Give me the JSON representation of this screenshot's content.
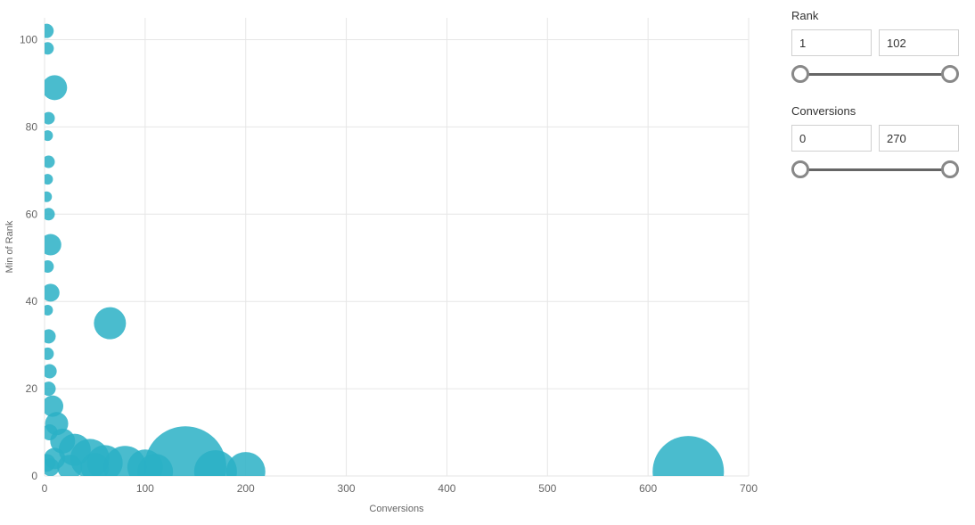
{
  "chart_data": {
    "type": "scatter",
    "xlabel": "Conversions",
    "ylabel": "Min of Rank",
    "xlim": [
      0,
      700
    ],
    "ylim": [
      0,
      105
    ],
    "x_ticks": [
      0,
      100,
      200,
      300,
      400,
      500,
      600,
      700
    ],
    "y_ticks": [
      0,
      20,
      40,
      60,
      80,
      100
    ],
    "series": [
      {
        "x": 2,
        "y": 102,
        "size": 8
      },
      {
        "x": 3,
        "y": 98,
        "size": 7
      },
      {
        "x": 10,
        "y": 89,
        "size": 14
      },
      {
        "x": 4,
        "y": 82,
        "size": 7
      },
      {
        "x": 3,
        "y": 78,
        "size": 6
      },
      {
        "x": 4,
        "y": 72,
        "size": 7
      },
      {
        "x": 3,
        "y": 68,
        "size": 6
      },
      {
        "x": 2,
        "y": 64,
        "size": 6
      },
      {
        "x": 4,
        "y": 60,
        "size": 7
      },
      {
        "x": 6,
        "y": 53,
        "size": 12
      },
      {
        "x": 3,
        "y": 48,
        "size": 7
      },
      {
        "x": 6,
        "y": 42,
        "size": 10
      },
      {
        "x": 3,
        "y": 38,
        "size": 6
      },
      {
        "x": 65,
        "y": 35,
        "size": 18
      },
      {
        "x": 4,
        "y": 32,
        "size": 8
      },
      {
        "x": 3,
        "y": 28,
        "size": 7
      },
      {
        "x": 5,
        "y": 24,
        "size": 8
      },
      {
        "x": 4,
        "y": 20,
        "size": 8
      },
      {
        "x": 8,
        "y": 16,
        "size": 12
      },
      {
        "x": 12,
        "y": 12,
        "size": 13
      },
      {
        "x": 5,
        "y": 10,
        "size": 9
      },
      {
        "x": 18,
        "y": 8,
        "size": 14
      },
      {
        "x": 30,
        "y": 6,
        "size": 18
      },
      {
        "x": 45,
        "y": 4,
        "size": 22
      },
      {
        "x": 10,
        "y": 4,
        "size": 12
      },
      {
        "x": 60,
        "y": 3,
        "size": 20
      },
      {
        "x": 80,
        "y": 2,
        "size": 24
      },
      {
        "x": 100,
        "y": 2,
        "size": 20
      },
      {
        "x": 140,
        "y": 2,
        "size": 46
      },
      {
        "x": 200,
        "y": 1,
        "size": 22
      },
      {
        "x": 640,
        "y": 1,
        "size": 40
      },
      {
        "x": 2,
        "y": 3,
        "size": 10
      },
      {
        "x": 6,
        "y": 2,
        "size": 10
      },
      {
        "x": 25,
        "y": 2,
        "size": 14
      },
      {
        "x": 50,
        "y": 2,
        "size": 16
      },
      {
        "x": 110,
        "y": 1,
        "size": 20
      },
      {
        "x": 170,
        "y": 1,
        "size": 24
      }
    ]
  },
  "filters": {
    "rank": {
      "title": "Rank",
      "min": "1",
      "max": "102"
    },
    "conversions": {
      "title": "Conversions",
      "min": "0",
      "max": "270"
    }
  }
}
